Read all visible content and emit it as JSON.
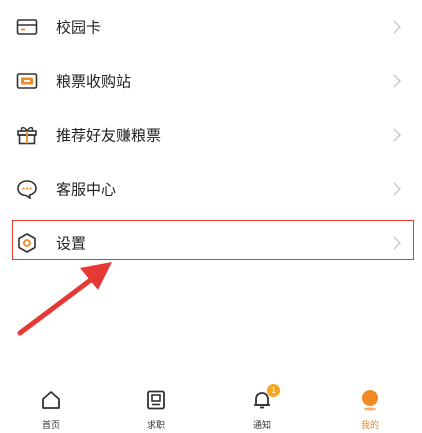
{
  "menu": {
    "items": [
      {
        "label": "校园卡",
        "icon": "card-icon"
      },
      {
        "label": "粮票收购站",
        "icon": "ticket-icon"
      },
      {
        "label": "推荐好友赚粮票",
        "icon": "gift-icon"
      },
      {
        "label": "客服中心",
        "icon": "chat-icon"
      },
      {
        "label": "设置",
        "icon": "settings-icon"
      }
    ]
  },
  "tabbar": {
    "tabs": [
      {
        "label": "首页",
        "icon": "home-icon"
      },
      {
        "label": "求职",
        "icon": "job-icon"
      },
      {
        "label": "通知",
        "icon": "bell-icon",
        "badge": "1"
      },
      {
        "label": "我的",
        "icon": "profile-icon",
        "active": true
      }
    ]
  },
  "colors": {
    "accent": "#f08a24",
    "highlight_border": "#e53935",
    "arrow": "#e53935",
    "badge": "#f5a623"
  }
}
